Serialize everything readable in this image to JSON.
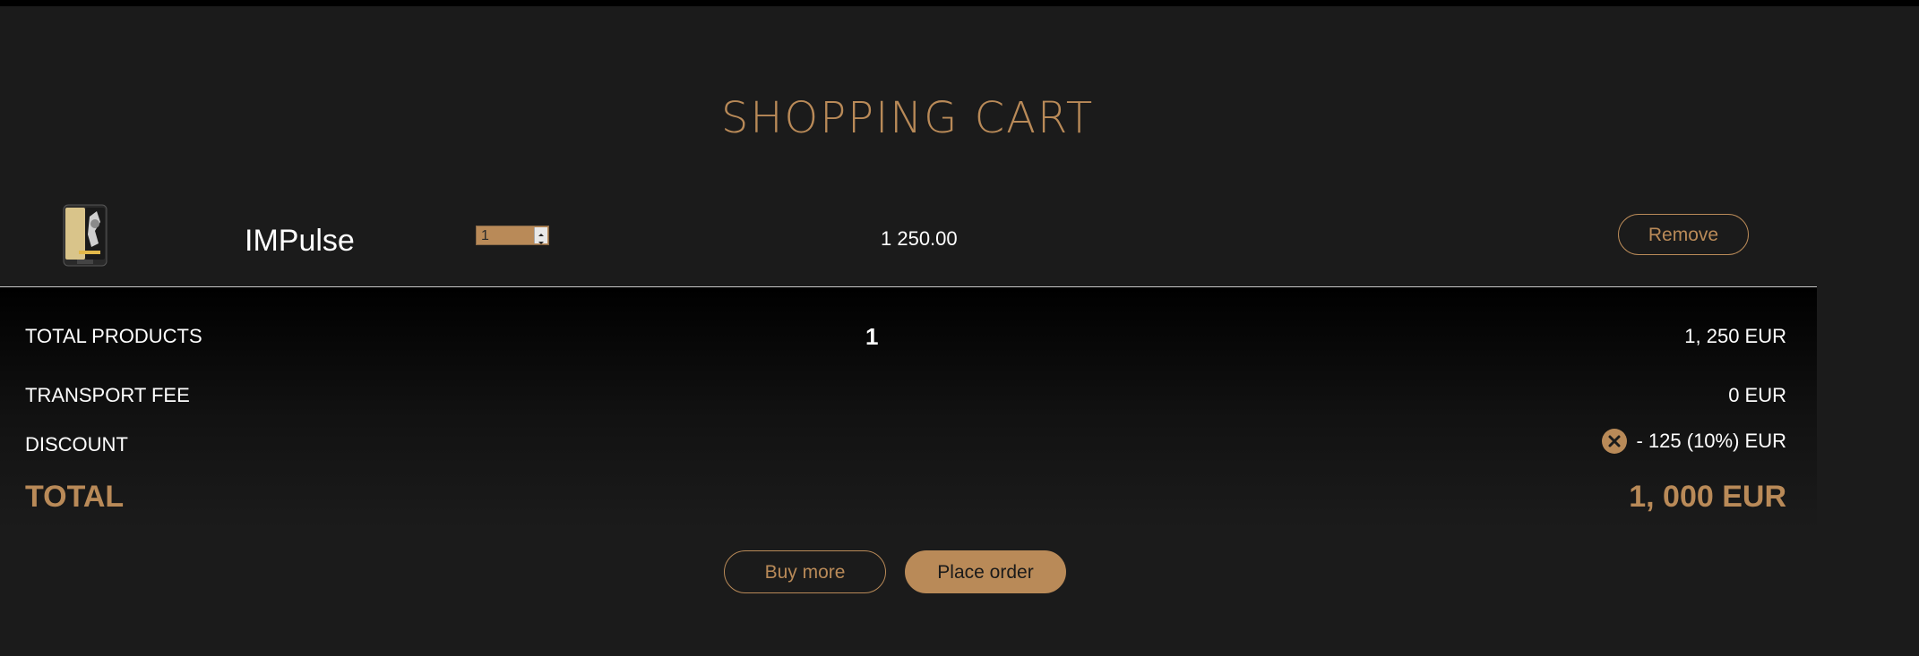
{
  "page": {
    "title": "SHOPPING CART"
  },
  "cart": {
    "items": [
      {
        "name": "IMPulse",
        "quantity": "1",
        "price": "1 250.00",
        "remove_label": "Remove",
        "thumbnail": "phone-product-icon"
      }
    ]
  },
  "summary": {
    "total_products_label": "TOTAL PRODUCTS",
    "total_products_count": "1",
    "total_products_value": "1, 250 EUR",
    "transport_fee_label": "TRANSPORT FEE",
    "transport_fee_value": "0 EUR",
    "discount_label": "DISCOUNT",
    "discount_value": "- 125 (10%) EUR",
    "discount_remove_icon": "close-icon",
    "total_label": "TOTAL",
    "total_value": "1, 000 EUR"
  },
  "actions": {
    "buy_more_label": "Buy more",
    "place_order_label": "Place order"
  },
  "colors": {
    "accent": "#b98a58",
    "background": "#1b1b1b",
    "panel": "#000000",
    "text": "#ffffff"
  }
}
